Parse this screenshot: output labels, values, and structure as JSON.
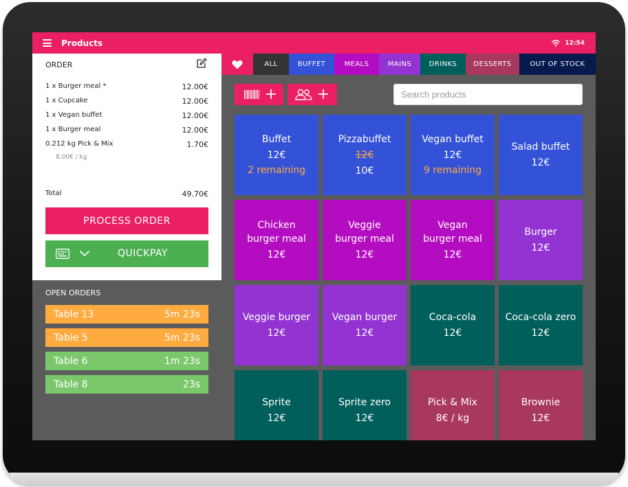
{
  "colors": {
    "brand": "#ea1f64",
    "green": "#4caf50",
    "orange": "#ffab40",
    "light_green": "#7bc86c",
    "blue": "#3452d8",
    "magenta": "#b40cc0",
    "purple": "#9334d2",
    "teal": "#015f5b",
    "rose": "#a9385e",
    "navy": "#061a4d"
  },
  "header": {
    "title": "Products",
    "time": "12:54",
    "menu_icon": "hamburger-menu-icon",
    "wifi_icon": "wifi-icon"
  },
  "order": {
    "heading": "ORDER",
    "edit_icon": "edit-icon",
    "lines": [
      {
        "name": "1 x Burger meal *",
        "price": "12.00€"
      },
      {
        "name": "1 x Cupcake",
        "price": "12.00€"
      },
      {
        "name": "1 x Vegan buffet",
        "price": "12.00€"
      },
      {
        "name": "1 x Burger meal",
        "price": "12.00€"
      },
      {
        "name": "0.212 kg Pick & Mix",
        "price": "1.70€"
      }
    ],
    "sub_note": "8.00€ / kg",
    "total_label": "Total",
    "total_value": "49.70€",
    "process_label": "PROCESS ORDER",
    "quickpay_label": "QUICKPAY"
  },
  "open_orders": {
    "title": "OPEN ORDERS",
    "items": [
      {
        "name": "Table 13",
        "time": "5m 23s",
        "color": "#ffab40"
      },
      {
        "name": "Table 5",
        "time": "5m 23s",
        "color": "#ffab40"
      },
      {
        "name": "Table 6",
        "time": "1m 23s",
        "color": "#7bc86c"
      },
      {
        "name": "Table 8",
        "time": "23s",
        "color": "#7bc86c"
      }
    ]
  },
  "tabs": [
    {
      "label": "ALL",
      "color": "#333333",
      "active": true
    },
    {
      "label": "BUFFET",
      "color": "#3452d8"
    },
    {
      "label": "MEALS",
      "color": "#b40cc0"
    },
    {
      "label": "MAINS",
      "color": "#9334d2"
    },
    {
      "label": "DRINKS",
      "color": "#015f5b"
    },
    {
      "label": "DESSERTS",
      "color": "#a9385e"
    },
    {
      "label": "OUT OF STOCK",
      "color": "#061a4d"
    }
  ],
  "search": {
    "placeholder": "Search products",
    "value": ""
  },
  "products": [
    {
      "name": "Buffet",
      "price": "12€",
      "remaining": "2 remaining",
      "color": "#3452d8"
    },
    {
      "name": "Pizzabuffet",
      "old_price": "12€",
      "price": "10€",
      "color": "#3452d8"
    },
    {
      "name": "Vegan buffet",
      "price": "12€",
      "remaining": "9 remaining",
      "color": "#3452d8"
    },
    {
      "name": "Salad buffet",
      "price": "12€",
      "color": "#3452d8"
    },
    {
      "name": "Chicken burger meal",
      "price": "12€",
      "color": "#b40cc0"
    },
    {
      "name": "Veggie burger meal",
      "price": "12€",
      "color": "#b40cc0"
    },
    {
      "name": "Vegan burger meal",
      "price": "12€",
      "color": "#b40cc0"
    },
    {
      "name": "Burger",
      "price": "12€",
      "color": "#9334d2"
    },
    {
      "name": "Veggie burger",
      "price": "12€",
      "color": "#9334d2"
    },
    {
      "name": "Vegan burger",
      "price": "12€",
      "color": "#9334d2"
    },
    {
      "name": "Coca-cola",
      "price": "12€",
      "color": "#015f5b"
    },
    {
      "name": "Coca-cola zero",
      "price": "12€",
      "color": "#015f5b"
    },
    {
      "name": "Sprite",
      "price": "12€",
      "color": "#015f5b"
    },
    {
      "name": "Sprite zero",
      "price": "12€",
      "color": "#015f5b"
    },
    {
      "name": "Pick & Mix",
      "price": "8€ / kg",
      "color": "#a9385e"
    },
    {
      "name": "Brownie",
      "price": "12€",
      "color": "#a9385e"
    }
  ]
}
